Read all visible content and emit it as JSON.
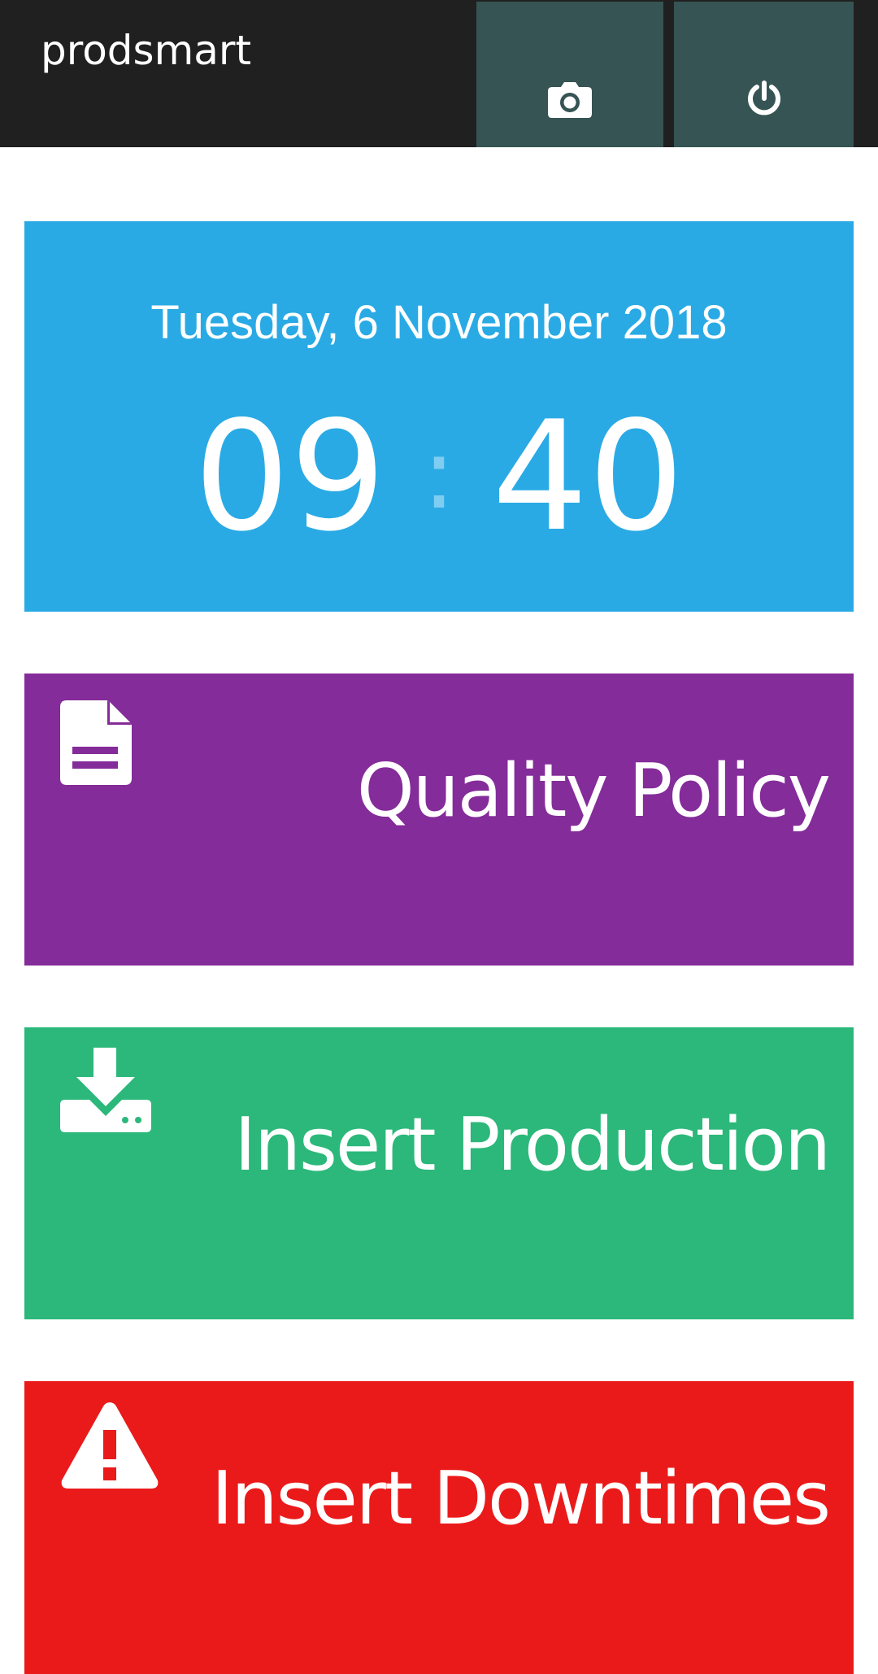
{
  "header": {
    "brand": "prodsmart",
    "buttons": [
      {
        "name": "camera",
        "icon": "camera-icon"
      },
      {
        "name": "power",
        "icon": "power-icon"
      }
    ]
  },
  "clock": {
    "date": "Tuesday, 6 November 2018",
    "hours": "09",
    "separator": ":",
    "minutes": "40"
  },
  "tiles": [
    {
      "label": "Quality Policy",
      "icon": "document-icon",
      "color": "#842c99"
    },
    {
      "label": "Insert Production",
      "icon": "download-tray-icon",
      "color": "#2bb87a"
    },
    {
      "label": "Insert Downtimes",
      "icon": "warning-icon",
      "color": "#ea1a1a"
    }
  ],
  "colors": {
    "topbar": "#202020",
    "topbar_button": "#365454",
    "clock_background": "#2aaae5"
  }
}
